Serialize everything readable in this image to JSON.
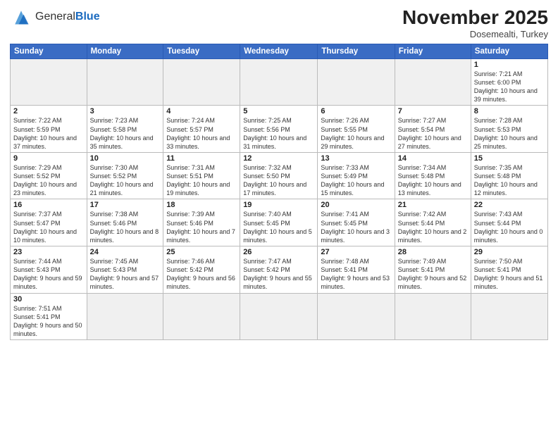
{
  "logo": {
    "text_normal": "General",
    "text_bold": "Blue"
  },
  "title": "November 2025",
  "subtitle": "Dosemealti, Turkey",
  "days_of_week": [
    "Sunday",
    "Monday",
    "Tuesday",
    "Wednesday",
    "Thursday",
    "Friday",
    "Saturday"
  ],
  "weeks": [
    [
      {
        "day": "",
        "info": ""
      },
      {
        "day": "",
        "info": ""
      },
      {
        "day": "",
        "info": ""
      },
      {
        "day": "",
        "info": ""
      },
      {
        "day": "",
        "info": ""
      },
      {
        "day": "",
        "info": ""
      },
      {
        "day": "1",
        "info": "Sunrise: 7:21 AM\nSunset: 6:00 PM\nDaylight: 10 hours and 39 minutes."
      }
    ],
    [
      {
        "day": "2",
        "info": "Sunrise: 7:22 AM\nSunset: 5:59 PM\nDaylight: 10 hours and 37 minutes."
      },
      {
        "day": "3",
        "info": "Sunrise: 7:23 AM\nSunset: 5:58 PM\nDaylight: 10 hours and 35 minutes."
      },
      {
        "day": "4",
        "info": "Sunrise: 7:24 AM\nSunset: 5:57 PM\nDaylight: 10 hours and 33 minutes."
      },
      {
        "day": "5",
        "info": "Sunrise: 7:25 AM\nSunset: 5:56 PM\nDaylight: 10 hours and 31 minutes."
      },
      {
        "day": "6",
        "info": "Sunrise: 7:26 AM\nSunset: 5:55 PM\nDaylight: 10 hours and 29 minutes."
      },
      {
        "day": "7",
        "info": "Sunrise: 7:27 AM\nSunset: 5:54 PM\nDaylight: 10 hours and 27 minutes."
      },
      {
        "day": "8",
        "info": "Sunrise: 7:28 AM\nSunset: 5:53 PM\nDaylight: 10 hours and 25 minutes."
      }
    ],
    [
      {
        "day": "9",
        "info": "Sunrise: 7:29 AM\nSunset: 5:52 PM\nDaylight: 10 hours and 23 minutes."
      },
      {
        "day": "10",
        "info": "Sunrise: 7:30 AM\nSunset: 5:52 PM\nDaylight: 10 hours and 21 minutes."
      },
      {
        "day": "11",
        "info": "Sunrise: 7:31 AM\nSunset: 5:51 PM\nDaylight: 10 hours and 19 minutes."
      },
      {
        "day": "12",
        "info": "Sunrise: 7:32 AM\nSunset: 5:50 PM\nDaylight: 10 hours and 17 minutes."
      },
      {
        "day": "13",
        "info": "Sunrise: 7:33 AM\nSunset: 5:49 PM\nDaylight: 10 hours and 15 minutes."
      },
      {
        "day": "14",
        "info": "Sunrise: 7:34 AM\nSunset: 5:48 PM\nDaylight: 10 hours and 13 minutes."
      },
      {
        "day": "15",
        "info": "Sunrise: 7:35 AM\nSunset: 5:48 PM\nDaylight: 10 hours and 12 minutes."
      }
    ],
    [
      {
        "day": "16",
        "info": "Sunrise: 7:37 AM\nSunset: 5:47 PM\nDaylight: 10 hours and 10 minutes."
      },
      {
        "day": "17",
        "info": "Sunrise: 7:38 AM\nSunset: 5:46 PM\nDaylight: 10 hours and 8 minutes."
      },
      {
        "day": "18",
        "info": "Sunrise: 7:39 AM\nSunset: 5:46 PM\nDaylight: 10 hours and 7 minutes."
      },
      {
        "day": "19",
        "info": "Sunrise: 7:40 AM\nSunset: 5:45 PM\nDaylight: 10 hours and 5 minutes."
      },
      {
        "day": "20",
        "info": "Sunrise: 7:41 AM\nSunset: 5:45 PM\nDaylight: 10 hours and 3 minutes."
      },
      {
        "day": "21",
        "info": "Sunrise: 7:42 AM\nSunset: 5:44 PM\nDaylight: 10 hours and 2 minutes."
      },
      {
        "day": "22",
        "info": "Sunrise: 7:43 AM\nSunset: 5:44 PM\nDaylight: 10 hours and 0 minutes."
      }
    ],
    [
      {
        "day": "23",
        "info": "Sunrise: 7:44 AM\nSunset: 5:43 PM\nDaylight: 9 hours and 59 minutes."
      },
      {
        "day": "24",
        "info": "Sunrise: 7:45 AM\nSunset: 5:43 PM\nDaylight: 9 hours and 57 minutes."
      },
      {
        "day": "25",
        "info": "Sunrise: 7:46 AM\nSunset: 5:42 PM\nDaylight: 9 hours and 56 minutes."
      },
      {
        "day": "26",
        "info": "Sunrise: 7:47 AM\nSunset: 5:42 PM\nDaylight: 9 hours and 55 minutes."
      },
      {
        "day": "27",
        "info": "Sunrise: 7:48 AM\nSunset: 5:41 PM\nDaylight: 9 hours and 53 minutes."
      },
      {
        "day": "28",
        "info": "Sunrise: 7:49 AM\nSunset: 5:41 PM\nDaylight: 9 hours and 52 minutes."
      },
      {
        "day": "29",
        "info": "Sunrise: 7:50 AM\nSunset: 5:41 PM\nDaylight: 9 hours and 51 minutes."
      }
    ],
    [
      {
        "day": "30",
        "info": "Sunrise: 7:51 AM\nSunset: 5:41 PM\nDaylight: 9 hours and 50 minutes."
      },
      {
        "day": "",
        "info": ""
      },
      {
        "day": "",
        "info": ""
      },
      {
        "day": "",
        "info": ""
      },
      {
        "day": "",
        "info": ""
      },
      {
        "day": "",
        "info": ""
      },
      {
        "day": "",
        "info": ""
      }
    ]
  ]
}
